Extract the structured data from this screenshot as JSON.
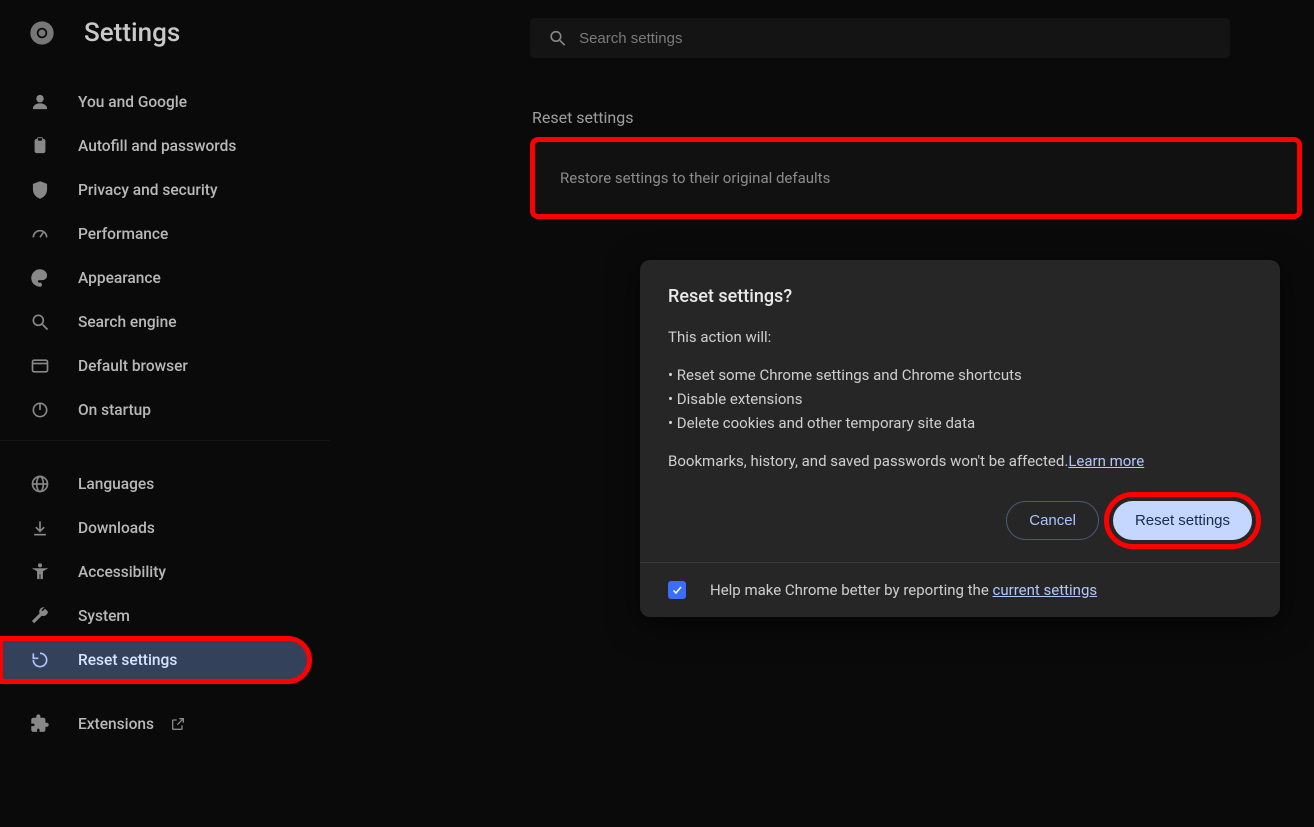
{
  "header": {
    "title": "Settings"
  },
  "search": {
    "placeholder": "Search settings"
  },
  "sidebar": {
    "items": [
      {
        "label": "You and Google"
      },
      {
        "label": "Autofill and passwords"
      },
      {
        "label": "Privacy and security"
      },
      {
        "label": "Performance"
      },
      {
        "label": "Appearance"
      },
      {
        "label": "Search engine"
      },
      {
        "label": "Default browser"
      },
      {
        "label": "On startup"
      },
      {
        "label": "Languages"
      },
      {
        "label": "Downloads"
      },
      {
        "label": "Accessibility"
      },
      {
        "label": "System"
      },
      {
        "label": "Reset settings"
      },
      {
        "label": "Extensions"
      }
    ]
  },
  "main": {
    "section_title": "Reset settings",
    "restore_label": "Restore settings to their original defaults"
  },
  "dialog": {
    "title": "Reset settings?",
    "intro": "This action will:",
    "bullets": [
      "Reset some Chrome settings and Chrome shortcuts",
      "Disable extensions",
      "Delete cookies and other temporary site data"
    ],
    "footer_text": "Bookmarks, history, and saved passwords won't be affected.",
    "learn_more": "Learn more",
    "cancel": "Cancel",
    "reset": "Reset settings",
    "checkbox_pre": "Help make Chrome better by reporting the ",
    "checkbox_link": "current settings"
  }
}
